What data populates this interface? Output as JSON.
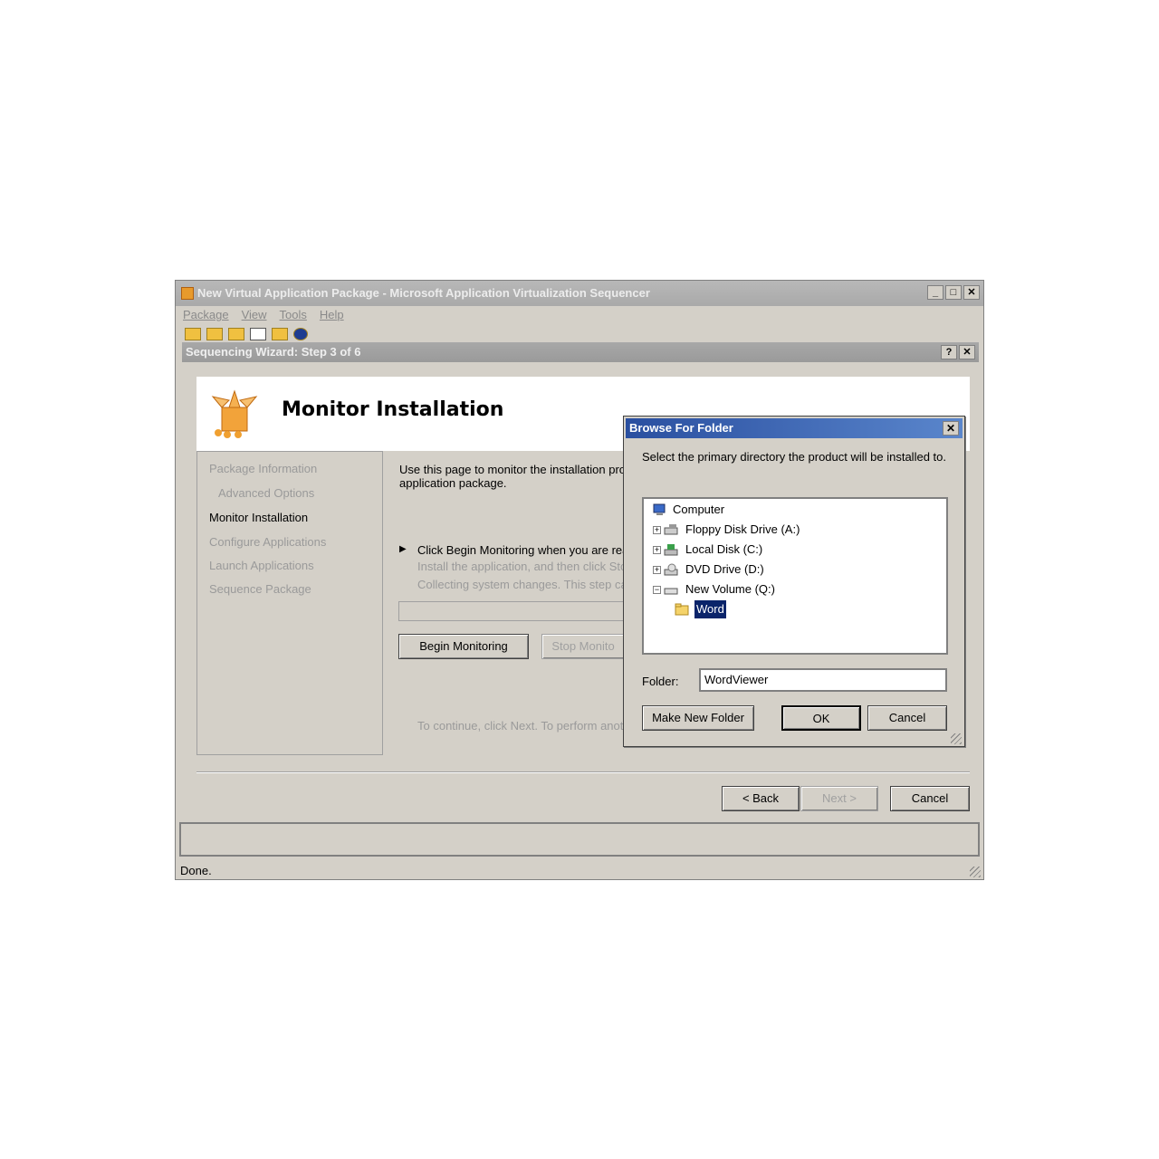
{
  "main_window": {
    "title": "New Virtual Application Package - Microsoft Application Virtualization Sequencer",
    "menu": [
      "Package",
      "View",
      "Tools",
      "Help"
    ]
  },
  "wizard": {
    "title": "Sequencing Wizard: Step 3 of 6",
    "page_title": "Monitor Installation",
    "steps": [
      {
        "label": "Package Information",
        "active": false
      },
      {
        "label": "Advanced Options",
        "active": false
      },
      {
        "label": "Monitor Installation",
        "active": true
      },
      {
        "label": "Configure Applications",
        "active": false
      },
      {
        "label": "Launch Applications",
        "active": false
      },
      {
        "label": "Sequence Package",
        "active": false
      }
    ],
    "intro_line1": "Use this page to monitor the installation proce",
    "intro_line2": "application package.",
    "instruction_main": "Click Begin Monitoring when you are reac",
    "instruction_sub1": "Install the application, and then click Stop",
    "instruction_sub2": "Collecting system changes. This step can",
    "begin_button": "Begin Monitoring",
    "stop_button": "Stop Monito",
    "continue_text": "To continue, click Next. To perform anoth",
    "back_button": "< Back",
    "next_button": "Next >",
    "cancel_button": "Cancel",
    "status": "Done."
  },
  "browse_dialog": {
    "title": "Browse For Folder",
    "prompt": "Select the primary directory the product will be installed to.",
    "tree": [
      {
        "label": "Computer",
        "icon": "computer-icon"
      },
      {
        "label": "Floppy Disk Drive (A:)",
        "icon": "floppy-drive-icon"
      },
      {
        "label": "Local Disk (C:)",
        "icon": "local-disk-icon"
      },
      {
        "label": "DVD Drive (D:)",
        "icon": "dvd-drive-icon"
      },
      {
        "label": "New Volume (Q:)",
        "icon": "volume-drive-icon"
      },
      {
        "label": "Word",
        "icon": "folder-icon",
        "selected": true
      }
    ],
    "folder_label": "Folder:",
    "folder_value": "WordViewer",
    "make_new_folder_button": "Make New Folder",
    "ok_button": "OK",
    "cancel_button": "Cancel"
  }
}
